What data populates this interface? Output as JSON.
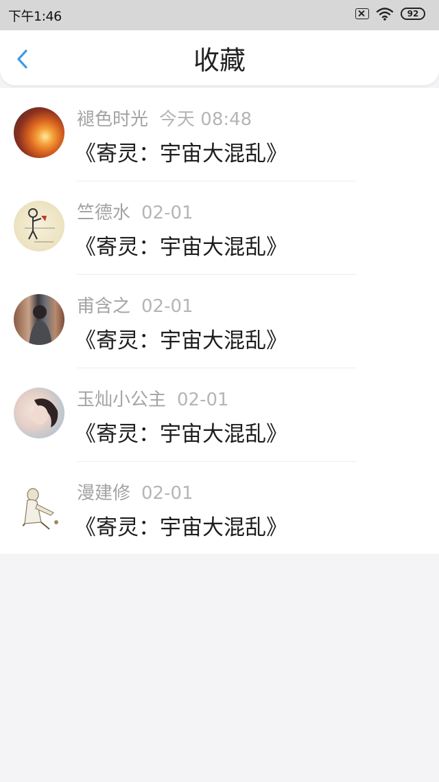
{
  "status_bar": {
    "time": "下午1:46",
    "battery": "92"
  },
  "header": {
    "title": "收藏"
  },
  "favorites": [
    {
      "user": "褪色时光",
      "date": "今天 08:48",
      "title": "《寄灵：宇宙大混乱》"
    },
    {
      "user": "竺德水",
      "date": "02-01",
      "title": "《寄灵：宇宙大混乱》"
    },
    {
      "user": "甫含之",
      "date": "02-01",
      "title": "《寄灵：宇宙大混乱》"
    },
    {
      "user": "玉灿小公主",
      "date": "02-01",
      "title": "《寄灵：宇宙大混乱》"
    },
    {
      "user": "漫建修",
      "date": "02-01",
      "title": "《寄灵：宇宙大混乱》"
    }
  ],
  "colors": {
    "accent": "#3d9be9",
    "page_bg": "#f4f3f5",
    "status_bar_bg": "#d7d7d7"
  }
}
